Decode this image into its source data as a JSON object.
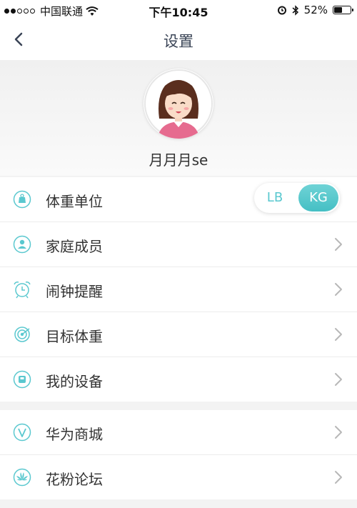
{
  "status_bar": {
    "carrier": "中国联通",
    "time": "下午10:45",
    "battery_percent": "52%",
    "battery_level": 0.52,
    "icons": [
      "signal-dots-icon",
      "wifi-icon",
      "alarm-icon",
      "bluetooth-icon",
      "battery-icon"
    ]
  },
  "nav": {
    "title": "设置",
    "back_icon": "chevron-left-icon"
  },
  "profile": {
    "username": "月月月se",
    "avatar": "avatar-girl-illustration"
  },
  "menu_group_1": [
    {
      "label": "体重单位",
      "icon": "weight-scale-icon"
    },
    {
      "label": "家庭成员",
      "icon": "person-icon"
    },
    {
      "label": "闹钟提醒",
      "icon": "alarm-clock-icon"
    },
    {
      "label": "目标体重",
      "icon": "target-icon"
    },
    {
      "label": "我的设备",
      "icon": "device-icon"
    }
  ],
  "unit_toggle": {
    "options": [
      "LB",
      "KG"
    ],
    "selected": "KG"
  },
  "menu_group_2": [
    {
      "label": "华为商城",
      "icon": "huawei-mall-icon"
    },
    {
      "label": "花粉论坛",
      "icon": "huawei-logo-icon"
    }
  ],
  "colors": {
    "accent": "#45bfc4",
    "icon_color": "#5ac8cf",
    "text": "#333333",
    "nav_title": "#3a4456",
    "background": "#f3f3f3"
  }
}
